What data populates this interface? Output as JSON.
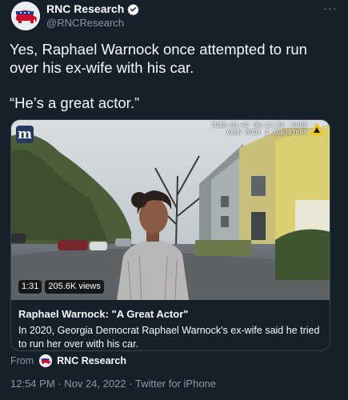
{
  "author": {
    "name": "RNC Research",
    "handle": "@RNCResearch",
    "verified": true,
    "avatar_icon": "gop-elephant-icon"
  },
  "more_label": "···",
  "tweet": {
    "text_line1": "Yes, Raphael Warnock once attempted to run over his ex-wife with his car.",
    "text_line2": "“He’s a great actor.”"
  },
  "card": {
    "logo_letter": "m",
    "camera_stamp": "2020-03-02 08:12:28 -0500\nAXON BODY 3 X6038769X",
    "video_duration": "1:31",
    "view_count": "205.6K views",
    "title": "Raphael Warnock: \"A Great Actor\"",
    "description": "In 2020, Georgia Democrat Raphael Warnock's ex-wife said he tried to run her over with his car."
  },
  "from": {
    "prefix": "From",
    "name": "RNC Research"
  },
  "meta": {
    "timestamp": "12:54 PM · Nov 24, 2022 · Twitter for iPhone"
  },
  "colors": {
    "background": "#15202b",
    "secondary_text": "#8b98a5",
    "verified_blue": "#1d9bf0",
    "card_border": "#38444d"
  }
}
